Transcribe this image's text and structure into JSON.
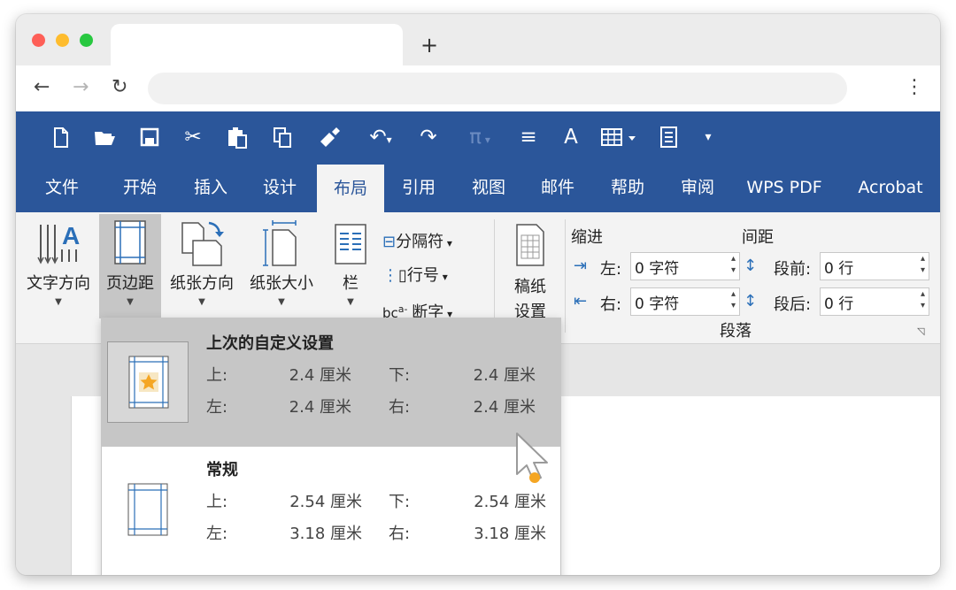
{
  "browser": {
    "new_tab_label": "+",
    "back_icon": "←",
    "forward_icon": "→",
    "reload_icon": "↻",
    "menu_icon": "⋮",
    "url": ""
  },
  "quick_access": {
    "new": "new-document-icon",
    "open": "open-folder-icon",
    "save": "save-icon",
    "cut": "cut-icon",
    "paste": "paste-icon",
    "copy": "copy-icon",
    "format_painter": "format-painter-icon",
    "undo": "undo-icon",
    "redo": "redo-icon",
    "equation": "equation-icon",
    "align": "align-icon",
    "font_style": "font-style-icon",
    "table": "table-icon",
    "document": "document-icon",
    "customize": "customize-icon"
  },
  "menus": [
    "文件",
    "开始",
    "插入",
    "设计",
    "布局",
    "引用",
    "视图",
    "邮件",
    "帮助",
    "审阅",
    "WPS PDF",
    "Acrobat"
  ],
  "active_menu": "布局",
  "ribbon": {
    "text_direction": "文字方向",
    "margins": "页边距",
    "orientation": "纸张方向",
    "size": "纸张大小",
    "columns": "栏",
    "breaks": "分隔符",
    "line_numbers": "行号",
    "hyphenation": "断字",
    "manuscript_line1": "稿纸",
    "manuscript_line2": "设置",
    "indent_header": "缩进",
    "spacing_header": "间距",
    "indent_left_label": "左:",
    "indent_left_value": "0 字符",
    "indent_right_label": "右:",
    "indent_right_value": "0 字符",
    "space_before_label": "段前:",
    "space_before_value": "0 行",
    "space_after_label": "段后:",
    "space_after_value": "0 行",
    "paragraph_group": "段落"
  },
  "margins_dropdown": {
    "options": [
      {
        "title": "上次的自定义设置",
        "top_label": "上:",
        "top": "2.4 厘米",
        "bottom_label": "下:",
        "bottom": "2.4 厘米",
        "left_label": "左:",
        "left": "2.4 厘米",
        "right_label": "右:",
        "right": "2.4 厘米"
      },
      {
        "title": "常规",
        "top_label": "上:",
        "top": "2.54 厘米",
        "bottom_label": "下:",
        "bottom": "2.54 厘米",
        "left_label": "左:",
        "left": "3.18 厘米",
        "right_label": "右:",
        "right": "3.18 厘米"
      }
    ]
  },
  "colors": {
    "word_blue": "#2b569a",
    "ribbon_bg": "#f3f3f3",
    "hover_gray": "#c6c6c6",
    "accent_orange": "#f5a623"
  }
}
